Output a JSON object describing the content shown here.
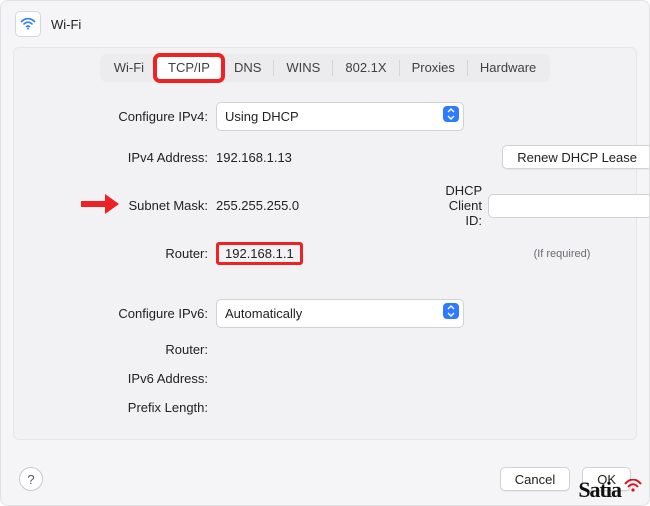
{
  "header": {
    "title": "Wi-Fi"
  },
  "tabs": [
    "Wi-Fi",
    "TCP/IP",
    "DNS",
    "WINS",
    "802.1X",
    "Proxies",
    "Hardware"
  ],
  "selected_tab_index": 1,
  "form": {
    "configure_ipv4_label": "Configure IPv4:",
    "configure_ipv4_value": "Using DHCP",
    "ipv4_address_label": "IPv4 Address:",
    "ipv4_address_value": "192.168.1.13",
    "subnet_mask_label": "Subnet Mask:",
    "subnet_mask_value": "255.255.255.0",
    "router_label": "Router:",
    "router_value": "192.168.1.1",
    "dhcp_client_id_label": "DHCP Client ID:",
    "dhcp_client_id_value": "",
    "dhcp_client_id_hint": "(If required)",
    "renew_lease_label": "Renew DHCP Lease",
    "configure_ipv6_label": "Configure IPv6:",
    "configure_ipv6_value": "Automatically",
    "router_v6_label": "Router:",
    "router_v6_value": "",
    "ipv6_address_label": "IPv6 Address:",
    "ipv6_address_value": "",
    "prefix_length_label": "Prefix Length:",
    "prefix_length_value": ""
  },
  "actions": {
    "cancel": "Cancel",
    "ok": "OK",
    "help": "?"
  },
  "watermark": "Satia"
}
